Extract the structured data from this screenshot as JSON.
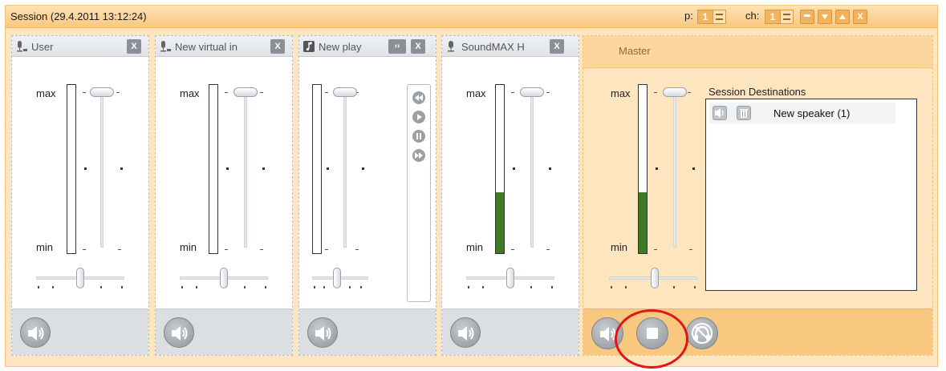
{
  "window": {
    "title": "Session (29.4.2011 13:12:24)",
    "p_label": "p:",
    "p_value": "1",
    "ch_label": "ch:",
    "ch_value": "1",
    "buttons": [
      "minimize",
      "move-down",
      "move-up",
      "close"
    ],
    "close_glyph": "X"
  },
  "strips": [
    {
      "name": "User",
      "icon": "microphone-icon",
      "meter_labels": {
        "max": "max",
        "min": "min"
      },
      "level": 0.0,
      "close_glyph": "X"
    },
    {
      "name": "New virtual in",
      "icon": "microphone-icon",
      "meter_labels": {
        "max": "max",
        "min": "min"
      },
      "level": 0.0,
      "close_glyph": "X"
    },
    {
      "name": "New play",
      "icon": "music-note-icon",
      "level": 0.0,
      "close_glyph": "X",
      "ff_glyph": "››"
    },
    {
      "name": "SoundMAX H",
      "icon": "microphone-icon",
      "meter_labels": {
        "max": "max",
        "min": "min"
      },
      "level": 0.36,
      "close_glyph": "X"
    }
  ],
  "master": {
    "name": "Master",
    "meter_labels": {
      "max": "max",
      "min": "min"
    },
    "level": 0.36,
    "destinations_title": "Session Destinations",
    "destinations": [
      "New speaker (1)"
    ]
  },
  "colors": {
    "accent": "#f9c880",
    "meter_fill": "#3d7a22",
    "highlight_ring": "#e0161b"
  }
}
